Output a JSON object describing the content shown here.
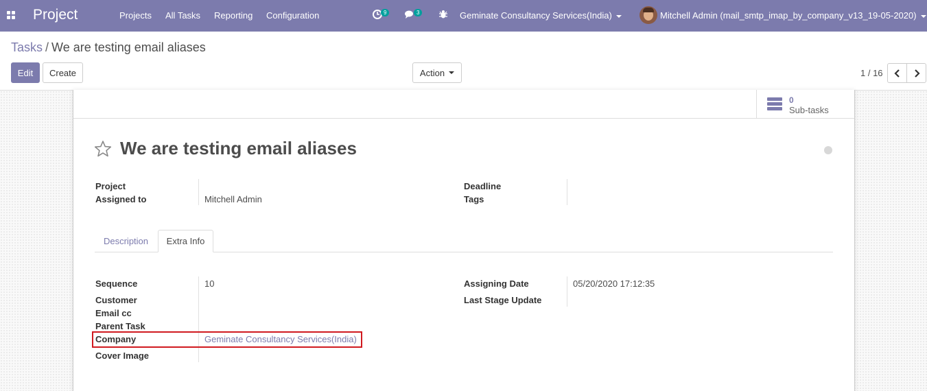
{
  "navbar": {
    "app_name": "Project",
    "menus": [
      "Projects",
      "All Tasks",
      "Reporting",
      "Configuration"
    ],
    "activity_badge": "9",
    "messages_badge": "3",
    "company": "Geminate Consultancy Services(India)",
    "user": "Mitchell Admin (mail_smtp_imap_by_company_v13_19-05-2020)",
    "icons": [
      "apps-grid-icon",
      "activity-clock-icon",
      "chat-icon",
      "bug-icon"
    ]
  },
  "control_panel": {
    "breadcrumb_parent": "Tasks",
    "breadcrumb_separator": "/",
    "breadcrumb_current": "We are testing email aliases",
    "edit_label": "Edit",
    "create_label": "Create",
    "action_label": "Action",
    "pager": "1 / 16"
  },
  "smart_button": {
    "value": "0",
    "label": "Sub-tasks"
  },
  "record": {
    "title": "We are testing email aliases",
    "fields_left": [
      {
        "label": "Project",
        "value": ""
      },
      {
        "label": "Assigned to",
        "value": "Mitchell Admin"
      }
    ],
    "fields_right": [
      {
        "label": "Deadline",
        "value": ""
      },
      {
        "label": "Tags",
        "value": ""
      }
    ]
  },
  "tabs": [
    {
      "label": "Description",
      "active": false
    },
    {
      "label": "Extra Info",
      "active": true
    }
  ],
  "extra_info": {
    "left": [
      {
        "label": "Sequence",
        "value": "10"
      },
      {
        "label": "Customer",
        "value": ""
      },
      {
        "label": "Email cc",
        "value": ""
      },
      {
        "label": "Parent Task",
        "value": ""
      },
      {
        "label": "Company",
        "value": "Geminate Consultancy Services(India)"
      },
      {
        "label": "Cover Image",
        "value": ""
      }
    ],
    "right": [
      {
        "label": "Assigning Date",
        "value": "05/20/2020 17:12:35"
      },
      {
        "label": "Last Stage Update",
        "value": ""
      }
    ]
  },
  "colors": {
    "brand": "#7c7bad",
    "badge": "#00a09d",
    "highlight": "#d0191f"
  }
}
